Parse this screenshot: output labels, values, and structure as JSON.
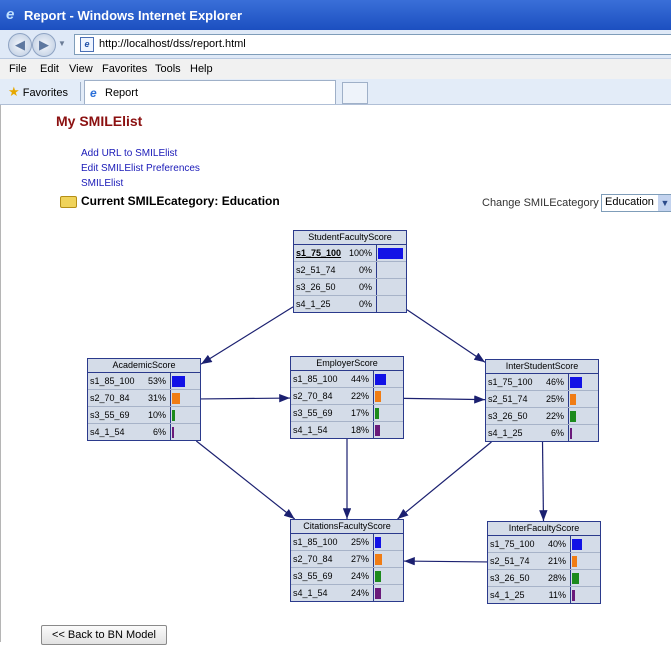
{
  "browser": {
    "window_title": "Report - Windows Internet Explorer",
    "url": "http://localhost/dss/report.html",
    "menu": [
      "File",
      "Edit",
      "View",
      "Favorites",
      "Tools",
      "Help"
    ],
    "favorites_label": "Favorites",
    "tab_title": "Report"
  },
  "page": {
    "heading": "My SMILElist",
    "links": [
      "Add URL to SMILElist",
      "Edit SMILElist Preferences",
      "SMILElist"
    ],
    "current_category": "Current SMILEcategory: Education",
    "change_category_label": "Change SMILEcategory :",
    "category_value": "Education",
    "back_button": "<< Back to BN Model"
  },
  "colors": {
    "s1": "#1212e6",
    "s2": "#f07c14",
    "s3": "#1c8a1c",
    "s4": "#6a1a7a"
  },
  "nodes": [
    {
      "id": "student",
      "name": "StudentFacultyScore",
      "selected_row": 0,
      "states": [
        {
          "label": "s1_75_100",
          "pct": "100%",
          "value": 100
        },
        {
          "label": "s2_51_74",
          "pct": "0%",
          "value": 0
        },
        {
          "label": "s3_26_50",
          "pct": "0%",
          "value": 0
        },
        {
          "label": "s4_1_25",
          "pct": "0%",
          "value": 0
        }
      ]
    },
    {
      "id": "academic",
      "name": "AcademicScore",
      "states": [
        {
          "label": "s1_85_100",
          "pct": "53%",
          "value": 53
        },
        {
          "label": "s2_70_84",
          "pct": "31%",
          "value": 31
        },
        {
          "label": "s3_55_69",
          "pct": "10%",
          "value": 10
        },
        {
          "label": "s4_1_54",
          "pct": "6%",
          "value": 6
        }
      ]
    },
    {
      "id": "employer",
      "name": "EmployerScore",
      "states": [
        {
          "label": "s1_85_100",
          "pct": "44%",
          "value": 44
        },
        {
          "label": "s2_70_84",
          "pct": "22%",
          "value": 22
        },
        {
          "label": "s3_55_69",
          "pct": "17%",
          "value": 17
        },
        {
          "label": "s4_1_54",
          "pct": "18%",
          "value": 18
        }
      ]
    },
    {
      "id": "interstudent",
      "name": "InterStudentScore",
      "states": [
        {
          "label": "s1_75_100",
          "pct": "46%",
          "value": 46
        },
        {
          "label": "s2_51_74",
          "pct": "25%",
          "value": 25
        },
        {
          "label": "s3_26_50",
          "pct": "22%",
          "value": 22
        },
        {
          "label": "s4_1_25",
          "pct": "6%",
          "value": 6
        }
      ]
    },
    {
      "id": "citations",
      "name": "CitationsFacultyScore",
      "states": [
        {
          "label": "s1_85_100",
          "pct": "25%",
          "value": 25
        },
        {
          "label": "s2_70_84",
          "pct": "27%",
          "value": 27
        },
        {
          "label": "s3_55_69",
          "pct": "24%",
          "value": 24
        },
        {
          "label": "s4_1_54",
          "pct": "24%",
          "value": 24
        }
      ]
    },
    {
      "id": "interfaculty",
      "name": "InterFacultyScore",
      "states": [
        {
          "label": "s1_75_100",
          "pct": "40%",
          "value": 40
        },
        {
          "label": "s2_51_74",
          "pct": "21%",
          "value": 21
        },
        {
          "label": "s3_26_50",
          "pct": "28%",
          "value": 28
        },
        {
          "label": "s4_1_25",
          "pct": "11%",
          "value": 11
        }
      ]
    }
  ],
  "edges": [
    [
      "student",
      "academic"
    ],
    [
      "student",
      "interstudent"
    ],
    [
      "academic",
      "employer"
    ],
    [
      "employer",
      "interstudent"
    ],
    [
      "academic",
      "citations"
    ],
    [
      "employer",
      "citations"
    ],
    [
      "interstudent",
      "citations"
    ],
    [
      "interstudent",
      "interfaculty"
    ],
    [
      "interfaculty",
      "citations"
    ]
  ]
}
